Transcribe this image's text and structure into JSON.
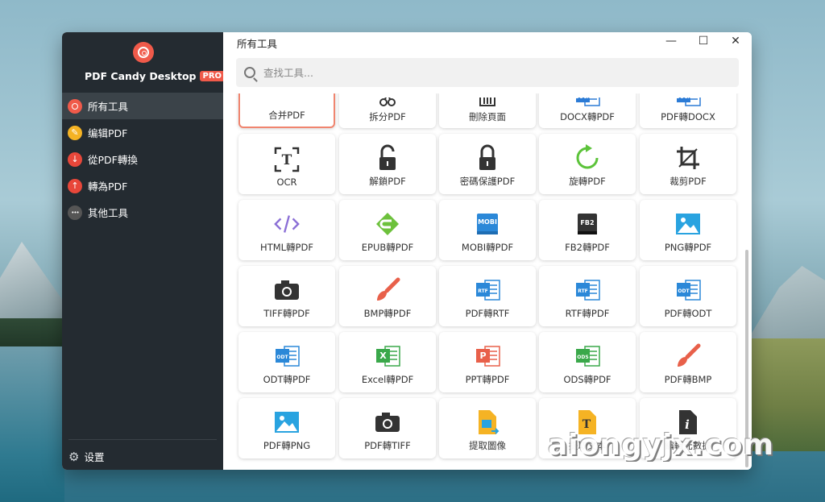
{
  "app": {
    "name": "PDF Candy Desktop",
    "badge": "PRO"
  },
  "sidebar": {
    "items": [
      {
        "label": "所有工具",
        "color": "#f05a4a",
        "icon": "lollipop-icon"
      },
      {
        "label": "编辑PDF",
        "color": "#f5b324",
        "icon": "edit-icon"
      },
      {
        "label": "從PDF轉換",
        "color": "#e8473a",
        "icon": "arrow-down-icon"
      },
      {
        "label": "轉為PDF",
        "color": "#e8473a",
        "icon": "arrow-up-icon"
      },
      {
        "label": "其他工具",
        "color": "#555555",
        "icon": "more-icon"
      }
    ],
    "settings_label": "设置"
  },
  "header": {
    "title": "所有工具",
    "search_placeholder": "查找工具..."
  },
  "tools": [
    {
      "label": "合并PDF",
      "icon": "merge-icon",
      "selected": true
    },
    {
      "label": "拆分PDF",
      "icon": "scissors-icon"
    },
    {
      "label": "刪除頁面",
      "icon": "trash-icon"
    },
    {
      "label": "DOCX轉PDF",
      "icon": "docx-icon"
    },
    {
      "label": "PDF轉DOCX",
      "icon": "docx-icon"
    },
    {
      "label": "OCR",
      "icon": "ocr-icon"
    },
    {
      "label": "解鎖PDF",
      "icon": "unlock-icon"
    },
    {
      "label": "密碼保護PDF",
      "icon": "lock-icon"
    },
    {
      "label": "旋轉PDF",
      "icon": "rotate-icon"
    },
    {
      "label": "裁剪PDF",
      "icon": "crop-icon"
    },
    {
      "label": "HTML轉PDF",
      "icon": "code-icon"
    },
    {
      "label": "EPUB轉PDF",
      "icon": "epub-icon"
    },
    {
      "label": "MOBI轉PDF",
      "icon": "mobi-icon"
    },
    {
      "label": "FB2轉PDF",
      "icon": "fb2-icon"
    },
    {
      "label": "PNG轉PDF",
      "icon": "image-icon"
    },
    {
      "label": "TIFF轉PDF",
      "icon": "camera-icon"
    },
    {
      "label": "BMP轉PDF",
      "icon": "brush-icon"
    },
    {
      "label": "PDF轉RTF",
      "icon": "rtf-icon"
    },
    {
      "label": "RTF轉PDF",
      "icon": "rtf-icon"
    },
    {
      "label": "PDF轉ODT",
      "icon": "odt-icon"
    },
    {
      "label": "ODT轉PDF",
      "icon": "odt-icon"
    },
    {
      "label": "Excel轉PDF",
      "icon": "excel-icon"
    },
    {
      "label": "PPT轉PDF",
      "icon": "ppt-icon"
    },
    {
      "label": "ODS轉PDF",
      "icon": "ods-icon"
    },
    {
      "label": "PDF轉BMP",
      "icon": "brush-icon"
    },
    {
      "label": "PDF轉PNG",
      "icon": "image-icon"
    },
    {
      "label": "PDF轉TIFF",
      "icon": "camera-icon"
    },
    {
      "label": "提取圖像",
      "icon": "extract-image-icon"
    },
    {
      "label": "提取文本",
      "icon": "extract-text-icon"
    },
    {
      "label": "編輯元數據",
      "icon": "info-icon"
    }
  ],
  "watermark": "aiongyjx.com",
  "colors": {
    "accent": "#f05a4a",
    "sidebar_bg": "#242b31",
    "sidebar_active": "#3b4349"
  }
}
